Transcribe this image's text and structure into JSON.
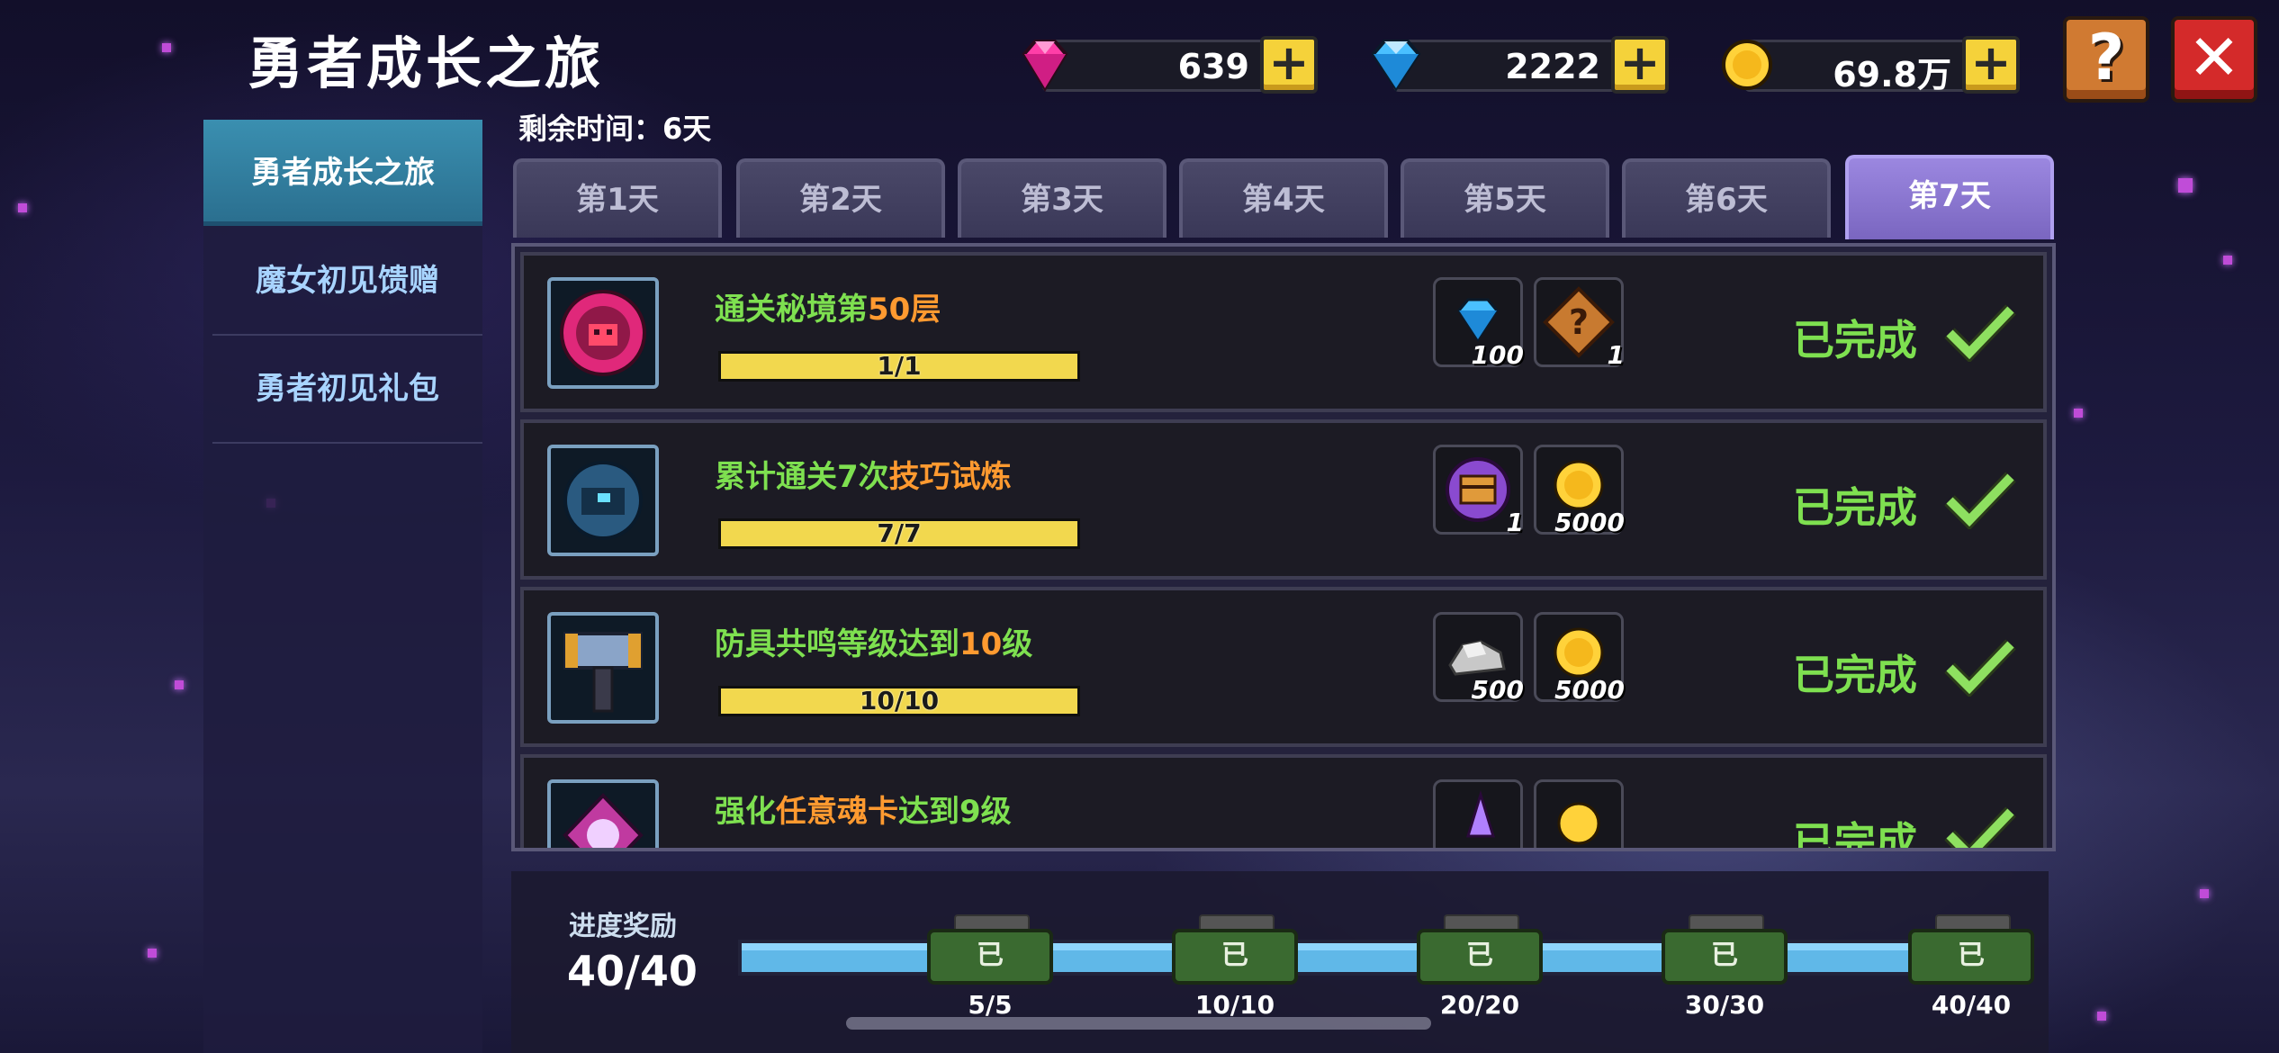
{
  "header": {
    "title": "勇者成长之旅",
    "remaining_label": "剩余时间：6天"
  },
  "currency": {
    "gems": "639",
    "diamonds": "2222",
    "gold": "69.8万"
  },
  "buttons": {
    "plus": "+",
    "help": "?",
    "close": "✕"
  },
  "sidebar": {
    "items": [
      {
        "label": "勇者成长之旅",
        "active": true
      },
      {
        "label": "魔女初见馈赠",
        "active": false
      },
      {
        "label": "勇者初见礼包",
        "active": false
      }
    ]
  },
  "tabs": [
    "第1天",
    "第2天",
    "第3天",
    "第4天",
    "第5天",
    "第6天",
    "第7天"
  ],
  "active_tab": 6,
  "tasks": [
    {
      "t1": "通关秘境第",
      "t2": "50层",
      "t3": "",
      "progress": "1/1",
      "fill": 1.0,
      "rewards": [
        {
          "icon": "diamond-icon",
          "count": "100"
        },
        {
          "icon": "mystery-box-icon",
          "count": "1"
        }
      ],
      "status": "已完成"
    },
    {
      "t1": "累计通关7次",
      "t2": "技巧试炼",
      "t3": "",
      "progress": "7/7",
      "fill": 1.0,
      "rewards": [
        {
          "icon": "chest-icon",
          "count": "1"
        },
        {
          "icon": "gold-coin-icon",
          "count": "5000"
        }
      ],
      "status": "已完成"
    },
    {
      "t1": "防具共鸣等级达到",
      "t2": "10",
      "t3": "级",
      "progress": "10/10",
      "fill": 1.0,
      "rewards": [
        {
          "icon": "ore-icon",
          "count": "500"
        },
        {
          "icon": "gold-coin-icon",
          "count": "5000"
        }
      ],
      "status": "已完成"
    },
    {
      "t1": "强化",
      "t2": "任意魂卡",
      "t3": "达到9级",
      "progress": "",
      "fill": 1.0,
      "rewards": [
        {
          "icon": "crystal-icon",
          "count": ""
        },
        {
          "icon": "gold-coin-icon",
          "count": ""
        }
      ],
      "status": "已完成"
    }
  ],
  "progress_rewards": {
    "label": "进度奖励",
    "count": "40/40",
    "fill": 1.0,
    "chest_label": "已",
    "milestones": [
      "5/5",
      "10/10",
      "20/20",
      "30/30",
      "40/40"
    ]
  },
  "colors": {
    "accent_green": "#7ee050",
    "accent_orange": "#ff9a30",
    "tab_active": "#8a76d0",
    "sidebar_active": "#3a8fb0"
  }
}
